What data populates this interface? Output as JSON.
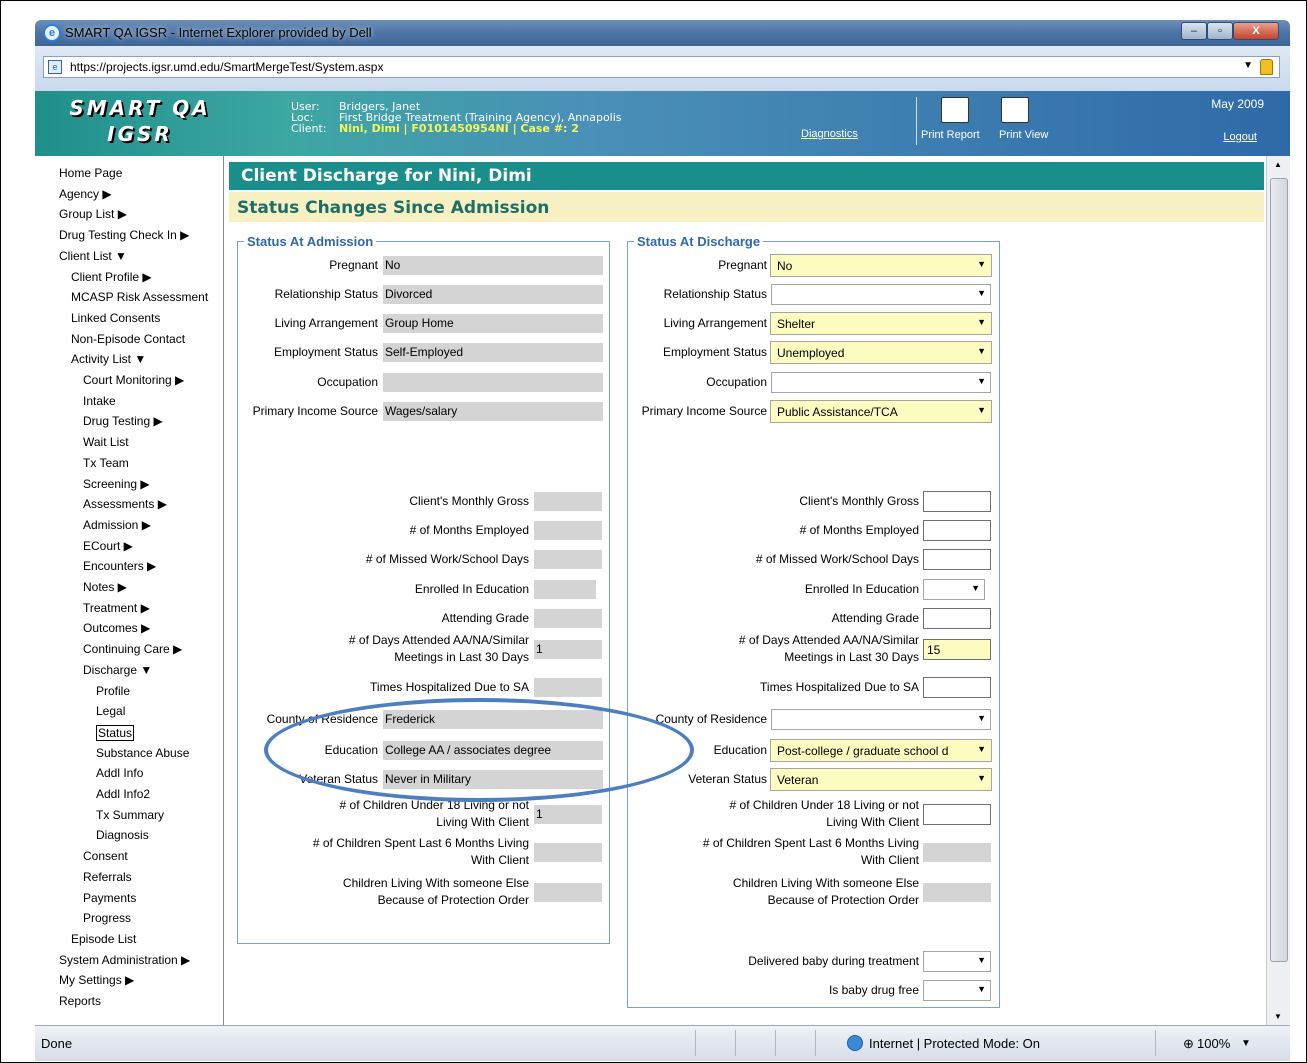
{
  "window": {
    "title": "SMART QA IGSR - Internet Explorer provided by Dell",
    "url": "https://projects.igsr.umd.edu/SmartMergeTest/System.aspx"
  },
  "header": {
    "logo_line1": "SMART QA",
    "logo_line2": "IGSR",
    "user_label": "User:",
    "user_value": "Bridgers, Janet",
    "loc_label": "Loc:",
    "loc_value": "First Bridge Treatment (Training Agency), Annapolis",
    "client_label": "Client:",
    "client_value": "Nini, Dimi | F0101450954NI | Case #: 2",
    "diagnostics": "Diagnostics",
    "print_report": "Print Report",
    "print_view": "Print View",
    "date": "May 2009",
    "logout": "Logout"
  },
  "nav": [
    {
      "label": "Home Page",
      "indent": 0
    },
    {
      "label": "Agency ▶",
      "indent": 0
    },
    {
      "label": "Group List ▶",
      "indent": 0
    },
    {
      "label": "Drug Testing Check In ▶",
      "indent": 0
    },
    {
      "label": "Client List ▼",
      "indent": 0
    },
    {
      "label": "Client Profile ▶",
      "indent": 1
    },
    {
      "label": "MCASP Risk Assessment",
      "indent": 1
    },
    {
      "label": "Linked Consents",
      "indent": 1
    },
    {
      "label": "Non-Episode Contact",
      "indent": 1
    },
    {
      "label": "Activity List ▼",
      "indent": 1
    },
    {
      "label": "Court Monitoring ▶",
      "indent": 2
    },
    {
      "label": "Intake",
      "indent": 2
    },
    {
      "label": "Drug Testing ▶",
      "indent": 2
    },
    {
      "label": "Wait List",
      "indent": 2
    },
    {
      "label": "Tx Team",
      "indent": 2
    },
    {
      "label": "Screening ▶",
      "indent": 2
    },
    {
      "label": "Assessments ▶",
      "indent": 2
    },
    {
      "label": "Admission ▶",
      "indent": 2
    },
    {
      "label": "ECourt ▶",
      "indent": 2
    },
    {
      "label": "Encounters ▶",
      "indent": 2
    },
    {
      "label": "Notes ▶",
      "indent": 2
    },
    {
      "label": "Treatment ▶",
      "indent": 2
    },
    {
      "label": "Outcomes ▶",
      "indent": 2
    },
    {
      "label": "Continuing Care ▶",
      "indent": 2
    },
    {
      "label": "Discharge ▼",
      "indent": 2
    },
    {
      "label": "Profile",
      "indent": 3
    },
    {
      "label": "Legal",
      "indent": 3
    },
    {
      "label": "Status",
      "indent": 3,
      "selected": true
    },
    {
      "label": "Substance Abuse",
      "indent": 3
    },
    {
      "label": "Addl Info",
      "indent": 3
    },
    {
      "label": "Addl Info2",
      "indent": 3
    },
    {
      "label": "Tx Summary",
      "indent": 3
    },
    {
      "label": "Diagnosis",
      "indent": 3
    },
    {
      "label": "Consent",
      "indent": 2
    },
    {
      "label": "Referrals",
      "indent": 2
    },
    {
      "label": "Payments",
      "indent": 2
    },
    {
      "label": "Progress",
      "indent": 2
    },
    {
      "label": "Episode List",
      "indent": 1
    },
    {
      "label": "System Administration ▶",
      "indent": 0
    },
    {
      "label": "My Settings ▶",
      "indent": 0
    },
    {
      "label": "Reports",
      "indent": 0
    }
  ],
  "page": {
    "title": "Client Discharge for Nini, Dimi",
    "subtitle": "Status Changes Since Admission"
  },
  "admission": {
    "legend": "Status At Admission",
    "top": [
      {
        "label": "Pregnant",
        "value": "No"
      },
      {
        "label": "Relationship Status",
        "value": "Divorced"
      },
      {
        "label": "Living Arrangement",
        "value": "Group Home"
      },
      {
        "label": "Employment Status",
        "value": "Self-Employed"
      },
      {
        "label": "Occupation",
        "value": ""
      },
      {
        "label": "Primary Income Source",
        "value": "Wages/salary"
      }
    ],
    "mid": [
      {
        "label": "Client's Monthly Gross",
        "value": ""
      },
      {
        "label": "# of Months Employed",
        "value": ""
      },
      {
        "label": "# of Missed Work/School Days",
        "value": ""
      },
      {
        "label": "Enrolled In Education",
        "value": ""
      },
      {
        "label": "Attending Grade",
        "value": ""
      },
      {
        "label": "# of Days Attended AA/NA/Similar Meetings in Last 30 Days",
        "value": "1"
      },
      {
        "label": "Times Hospitalized Due to SA",
        "value": ""
      }
    ],
    "low": [
      {
        "label": "County of Residence",
        "value": "Frederick"
      },
      {
        "label": "Education",
        "value": "College AA / associates degree"
      },
      {
        "label": "Veteran Status",
        "value": "Never in Military"
      }
    ],
    "bottom": [
      {
        "label": "# of Children Under 18 Living or not Living With Client",
        "value": "1"
      },
      {
        "label": "# of Children Spent Last 6 Months Living With Client",
        "value": ""
      },
      {
        "label": "Children Living With someone Else Because of Protection Order",
        "value": ""
      }
    ]
  },
  "discharge": {
    "legend": "Status At Discharge",
    "top": [
      {
        "label": "Pregnant",
        "value": "No"
      },
      {
        "label": "Relationship Status",
        "value": ""
      },
      {
        "label": "Living Arrangement",
        "value": "Shelter"
      },
      {
        "label": "Employment Status",
        "value": "Unemployed"
      },
      {
        "label": "Occupation",
        "value": ""
      },
      {
        "label": "Primary Income Source",
        "value": "Public Assistance/TCA"
      }
    ],
    "mid": [
      {
        "label": "Client's Monthly Gross",
        "value": ""
      },
      {
        "label": "# of Months Employed",
        "value": ""
      },
      {
        "label": "# of Missed Work/School Days",
        "value": ""
      },
      {
        "label": "Enrolled In Education",
        "value": ""
      },
      {
        "label": "Attending Grade",
        "value": ""
      },
      {
        "label": "# of Days Attended AA/NA/Similar Meetings in Last 30 Days",
        "value": "15"
      },
      {
        "label": "Times Hospitalized Due to SA",
        "value": ""
      }
    ],
    "low": [
      {
        "label": "County of Residence",
        "value": ""
      },
      {
        "label": "Education",
        "value": "Post-college / graduate school d"
      },
      {
        "label": "Veteran Status",
        "value": "Veteran"
      }
    ],
    "bottom": [
      {
        "label": "# of Children Under 18 Living or not Living With Client",
        "value": ""
      },
      {
        "label": "# of Children Spent Last 6 Months Living With Client",
        "value": ""
      },
      {
        "label": "Children Living With someone Else Because of Protection Order",
        "value": ""
      }
    ],
    "extra": [
      {
        "label": "Delivered baby during treatment",
        "value": ""
      },
      {
        "label": "Is baby drug free",
        "value": ""
      }
    ]
  },
  "status": {
    "text": "Done",
    "zone": "Internet | Protected Mode: On",
    "zoom": "100%"
  },
  "colors": {
    "teal": "#1a8e8a",
    "highlight": "#fdfcc0",
    "annotation": "#4c7ec0"
  }
}
